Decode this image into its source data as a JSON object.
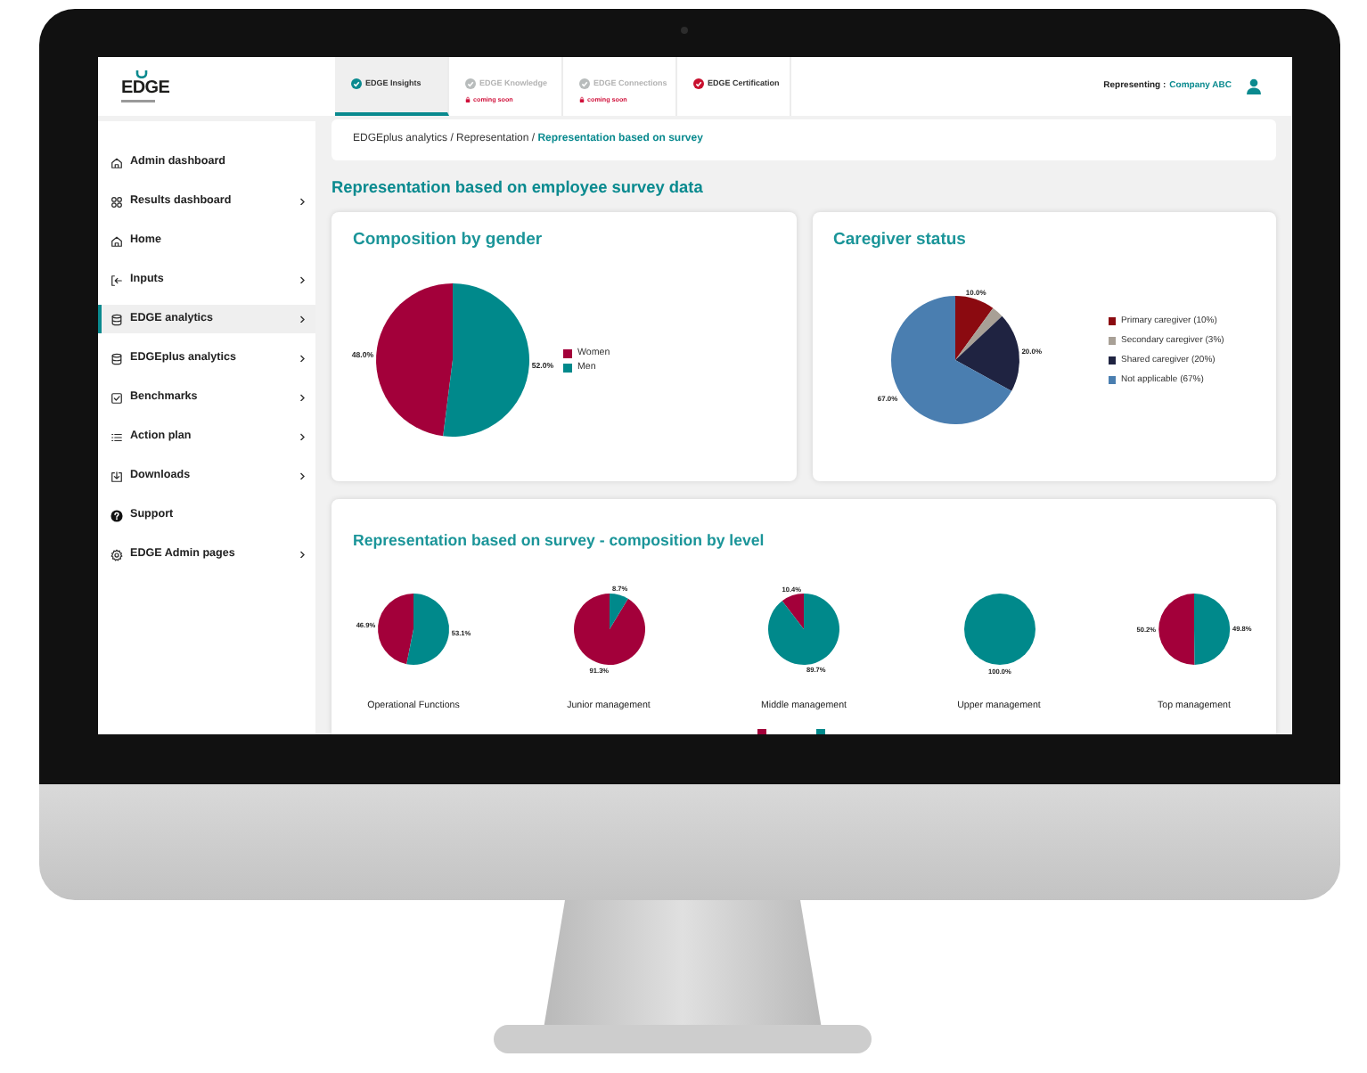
{
  "header": {
    "logo": "EDGE",
    "tabs": [
      {
        "label": "EDGE Insights",
        "selected": true,
        "disabled": false,
        "color": "#0a8a8f"
      },
      {
        "label": "EDGE Knowledge",
        "selected": false,
        "disabled": true,
        "color": "#b8bcbc",
        "note": "coming soon"
      },
      {
        "label": "EDGE Connections",
        "selected": false,
        "disabled": true,
        "color": "#b8bcbc",
        "note": "coming soon"
      },
      {
        "label": "EDGE Certification",
        "selected": false,
        "disabled": false,
        "color": "#c8102e"
      }
    ],
    "representing_label": "Representing :",
    "organization": "Company ABC"
  },
  "sidebar": {
    "items": [
      {
        "label": "Admin dashboard",
        "selected": false,
        "expandable": false
      },
      {
        "label": "Results dashboard",
        "selected": false,
        "expandable": true
      },
      {
        "label": "Home",
        "selected": false,
        "expandable": false
      },
      {
        "label": "Inputs",
        "selected": false,
        "expandable": true
      },
      {
        "label": "EDGE analytics",
        "selected": true,
        "expandable": true
      },
      {
        "label": "EDGEplus analytics",
        "selected": false,
        "expandable": true
      },
      {
        "label": "Benchmarks",
        "selected": false,
        "expandable": true
      },
      {
        "label": "Action plan",
        "selected": false,
        "expandable": true
      },
      {
        "label": "Downloads",
        "selected": false,
        "expandable": true
      },
      {
        "label": "Support",
        "selected": false,
        "expandable": false
      },
      {
        "label": "EDGE Admin pages",
        "selected": false,
        "expandable": true
      }
    ]
  },
  "breadcrumb": "EDGEplus analytics / Representation / **Representation based on survey**",
  "page_title": "Representation based on employee survey data",
  "gender_card": {
    "title": "Composition by gender",
    "slices": [
      {
        "color": "#a3003a"
      },
      {
        "color": "#00898b"
      }
    ],
    "chart_data": {
      "type": "pie",
      "orientation": "counterclockwise",
      "categories": [
        "Women",
        "Men"
      ],
      "values": [
        48.0,
        52.0
      ],
      "value_labels": [
        "48.0%",
        "52.0%"
      ],
      "legend": "right"
    }
  },
  "caregiver_card": {
    "title": "Caregiver status",
    "slices": [
      {
        "color": "#8b0a10"
      },
      {
        "color": "#a8a096"
      },
      {
        "color": "#1f2341"
      },
      {
        "color": "#4a7eb0"
      }
    ],
    "chart_data": {
      "type": "pie",
      "orientation": "clockwise",
      "categories": [
        "Primary caregiver (10%)",
        "Secondary caregiver (3%)",
        "Shared caregiver (20%)",
        "Not applicable (67%)"
      ],
      "values": [
        10.0,
        3.0,
        20.0,
        67.0
      ],
      "value_labels": [
        "10.0%",
        null,
        "20.0%",
        "67.0%"
      ],
      "legend": "right"
    }
  },
  "level_card": {
    "title": "Representation based on survey - composition by level",
    "legend": [
      {
        "color": "#a3003a"
      },
      {
        "color": "#00898b"
      }
    ],
    "charts": [
      {
        "chart_data": {
          "type": "pie",
          "title": "Operational Functions",
          "orientation": "counterclockwise",
          "values": [
            46.9,
            53.1
          ],
          "value_labels": [
            "46.9%",
            "53.1%"
          ]
        }
      },
      {
        "chart_data": {
          "type": "pie",
          "title": "Junior management",
          "orientation": "counterclockwise",
          "values": [
            91.3,
            8.7
          ],
          "value_labels": [
            "91.3%",
            "8.7%"
          ]
        }
      },
      {
        "chart_data": {
          "type": "pie",
          "title": "Middle management",
          "orientation": "counterclockwise",
          "values": [
            10.4,
            89.7
          ],
          "value_labels": [
            "10.4%",
            "89.7%"
          ]
        }
      },
      {
        "chart_data": {
          "type": "pie",
          "title": "Upper management",
          "orientation": "counterclockwise",
          "values": [
            0,
            100.0
          ],
          "value_labels": [
            null,
            "100.0%"
          ]
        }
      },
      {
        "chart_data": {
          "type": "pie",
          "title": "Top management",
          "orientation": "counterclockwise",
          "values": [
            50.2,
            49.8
          ],
          "value_labels": [
            "50.2%",
            "49.8%"
          ]
        }
      }
    ]
  }
}
